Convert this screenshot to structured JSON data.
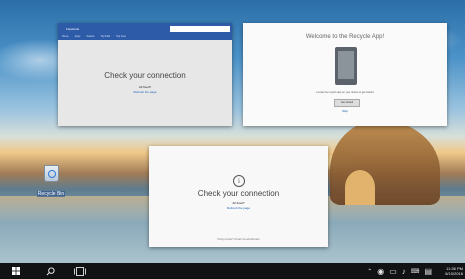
{
  "desktop": {
    "icon": {
      "label": "Recycle Bin",
      "icon": "recycle-bin-icon"
    }
  },
  "window_store": {
    "title": "Facebook",
    "tabs": [
      "Home",
      "Apps",
      "Games",
      "Top Paid",
      "Top Free"
    ],
    "message": "Check your connection",
    "sub": "All fixed?",
    "link": "Refresh the page"
  },
  "window_recycle": {
    "title": "Welcome to the Recycle App!",
    "description": "Locate the recycle app on your device to get started",
    "button": "Get started",
    "skip": "Skip"
  },
  "window_connection": {
    "message": "Check your connection",
    "sub": "All fixed?",
    "link": "Refresh the page",
    "footer": "Having trouble? Contact the administrator"
  },
  "taskbar": {
    "start_icon": "windows-logo-icon",
    "search_icon": "search-icon",
    "task_view_icon": "task-view-icon",
    "tray_icons": [
      "chevron-up-icon",
      "network-icon",
      "battery-icon",
      "volume-icon",
      "keyboard-icon",
      "notification-icon"
    ],
    "time": "11:36 PM",
    "date": "6/10/2016"
  }
}
